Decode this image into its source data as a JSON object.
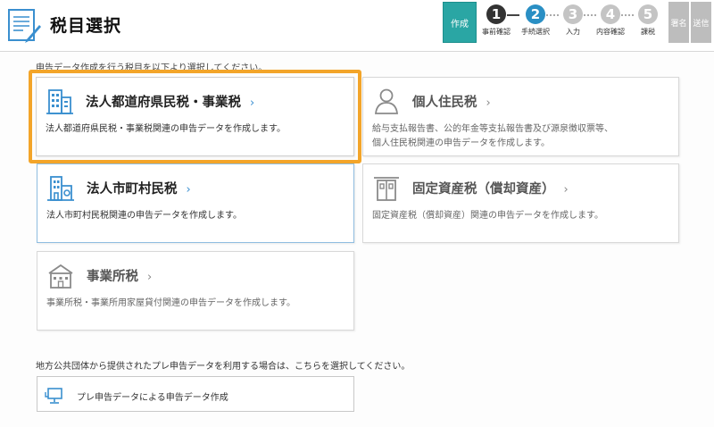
{
  "header": {
    "title": "税目選択"
  },
  "steps": {
    "create_label": "作成",
    "items": [
      {
        "num": "1",
        "label": "事前確認",
        "color": "#333333"
      },
      {
        "num": "2",
        "label": "手続選択",
        "color": "#2a8fc4"
      },
      {
        "num": "3",
        "label": "入力",
        "color": "#bdbdbd"
      },
      {
        "num": "4",
        "label": "内容確認",
        "color": "#bdbdbd"
      },
      {
        "num": "5",
        "label": "課税",
        "color": "#bdbdbd"
      }
    ],
    "sign_label": "署名",
    "send_label": "送信"
  },
  "instruction": "申告データ作成を行う税目を以下より選択してください。",
  "cards": {
    "corporate_prefectural": {
      "title": "法人都道府県民税・事業税",
      "desc": "法人都道府県民税・事業税関連の申告データを作成します。"
    },
    "individual": {
      "title": "個人住民税",
      "desc_line1": "給与支払報告書、公的年金等支払報告書及び源泉徴収票等、",
      "desc_line2": "個人住民税関連の申告データを作成します。"
    },
    "corporate_municipal": {
      "title": "法人市町村民税",
      "desc": "法人市町村民税関連の申告データを作成します。"
    },
    "fixed_asset": {
      "title": "固定資産税（償却資産）",
      "desc": "固定資産税（償却資産）関連の申告データを作成します。"
    },
    "business_office": {
      "title": "事業所税",
      "desc": "事業所税・事業所用家屋貸付関連の申告データを作成します。"
    }
  },
  "chevron": "›",
  "pre_note": "地方公共団体から提供されたプレ申告データを利用する場合は、こちらを選択してください。",
  "pre_button_label": "プレ申告データによる申告データ作成",
  "colors": {
    "accent_teal": "#2aa6a4",
    "highlight_orange": "#f3a52a",
    "link_blue": "#3b8fd1"
  }
}
